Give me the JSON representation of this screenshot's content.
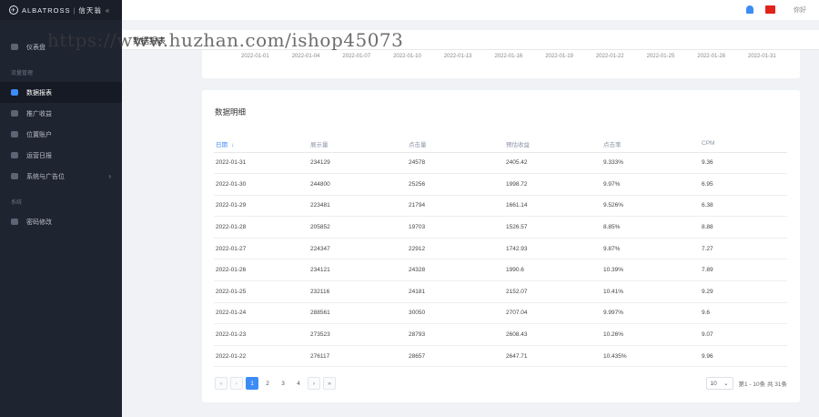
{
  "sidebar": {
    "brand": {
      "name": "ALBATROSS",
      "sub": "信天翁",
      "collapse": "«"
    },
    "items_top": [
      {
        "label": "仪表盘"
      }
    ],
    "group1": "流量管理",
    "items_group1": [
      {
        "label": "数据报表",
        "active": true
      },
      {
        "label": "推广收益"
      },
      {
        "label": "位置账户"
      },
      {
        "label": "运营日报"
      },
      {
        "label": "系统与广告位",
        "arrow": "›"
      }
    ],
    "group2": "系统",
    "items_group2": [
      {
        "label": "密码修改"
      }
    ]
  },
  "topbar": {
    "user": "你好"
  },
  "breadcrumb": {
    "title": "数据报表"
  },
  "chart_axis": {
    "ticks": [
      "2022-01-01",
      "2022-01-04",
      "2022-01-07",
      "2022-01-10",
      "2022-01-13",
      "2022-01-16",
      "2022-01-19",
      "2022-01-22",
      "2022-01-25",
      "2022-01-28",
      "2022-01-31"
    ]
  },
  "table": {
    "title": "数据明细",
    "columns": [
      "日期",
      "展示量",
      "点击量",
      "预估收益",
      "点击率",
      "CPM"
    ],
    "sort_icon": "↓",
    "rows": [
      [
        "2022-01-31",
        "234129",
        "24578",
        "2405.42",
        "9.333%",
        "9.36"
      ],
      [
        "2022-01-30",
        "244800",
        "25256",
        "1998.72",
        "9.97%",
        "6.95"
      ],
      [
        "2022-01-29",
        "223481",
        "21794",
        "1661.14",
        "9.526%",
        "6.38"
      ],
      [
        "2022-01-28",
        "205852",
        "19703",
        "1526.57",
        "8.85%",
        "8.88"
      ],
      [
        "2022-01-27",
        "224347",
        "22912",
        "1742.93",
        "9.87%",
        "7.27"
      ],
      [
        "2022-01-26",
        "234121",
        "24328",
        "1990.6",
        "10.39%",
        "7.89"
      ],
      [
        "2022-01-25",
        "232116",
        "24181",
        "2152.07",
        "10.41%",
        "9.29"
      ],
      [
        "2022-01-24",
        "288561",
        "30050",
        "2707.04",
        "9.997%",
        "9.6"
      ],
      [
        "2022-01-23",
        "273523",
        "28793",
        "2608.43",
        "10.26%",
        "9.07"
      ],
      [
        "2022-01-22",
        "276117",
        "28657",
        "2647.71",
        "10.435%",
        "9.96"
      ]
    ]
  },
  "pagination": {
    "first": "«",
    "prev": "‹",
    "pages": [
      "1",
      "2",
      "3",
      "4"
    ],
    "current": "1",
    "next": "›",
    "last": "»",
    "page_size": "10",
    "size_caret": "⌄",
    "summary": "第1 - 10条 共 31条"
  },
  "watermark": "https://www.huzhan.com/ishop45073",
  "colors": {
    "accent": "#3b8cf5",
    "sidebar": "#1f2431",
    "bell": "#3b8cf5",
    "flag": "#e2231a"
  }
}
